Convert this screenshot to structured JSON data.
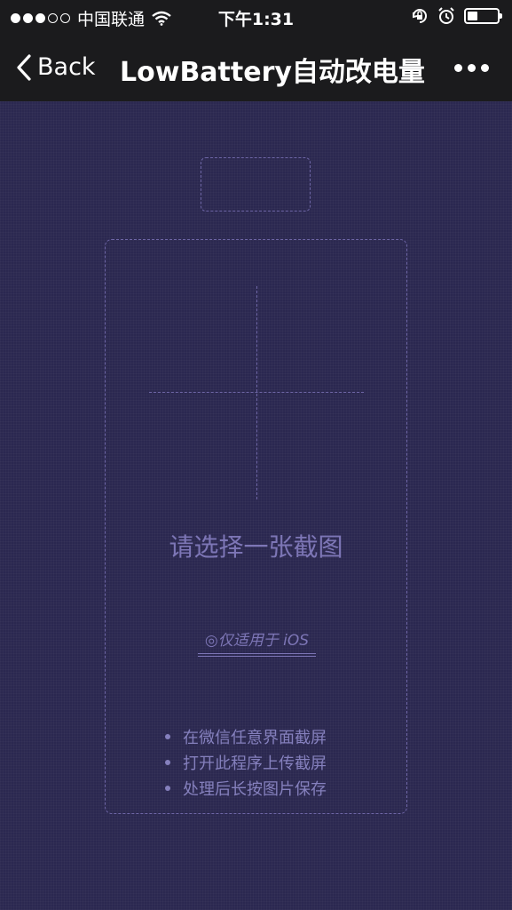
{
  "status_bar": {
    "carrier": "中国联通",
    "time": "下午1:31",
    "signal_strength": 3,
    "signal_max": 5,
    "battery_level": 0.35
  },
  "nav": {
    "back_label": "Back",
    "title": "LowBattery自动改电量"
  },
  "main": {
    "prompt": "请选择一张截图",
    "ios_note": "◎仅适用于 iOS",
    "tips": [
      "在微信任意界面截屏",
      "打开此程序上传截屏",
      "处理后长按图片保存"
    ]
  },
  "colors": {
    "background": "#2b2850",
    "bar": "#1b1b1d",
    "accent": "#7d76b6"
  }
}
